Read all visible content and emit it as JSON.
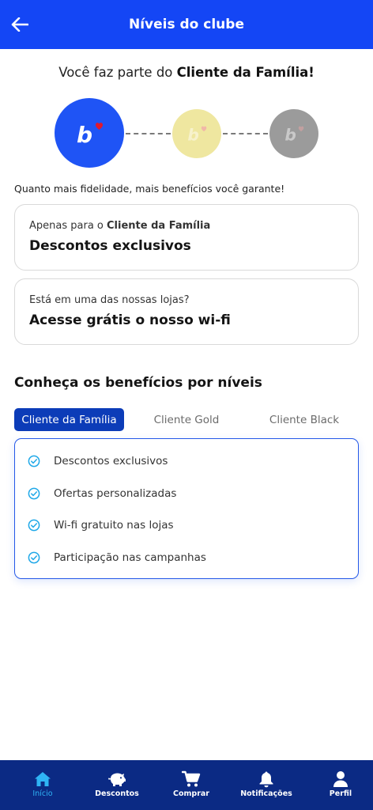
{
  "header": {
    "title": "Níveis do clube",
    "back_icon": "arrow-left-icon",
    "color": "#1446f5"
  },
  "membership": {
    "prefix": "Você faz parte do ",
    "level_name": "Cliente da Família!"
  },
  "levels": [
    {
      "name": "Cliente da Família",
      "color": "#1f54f5",
      "icon": "brand-b-heart-icon",
      "active": true
    },
    {
      "name": "Cliente Gold",
      "color": "#efe7a0",
      "icon": "brand-b-heart-icon",
      "active": false
    },
    {
      "name": "Cliente Black",
      "color": "#9b9b9b",
      "icon": "brand-b-heart-icon",
      "active": false
    }
  ],
  "intro": "Quanto mais fidelidade, mais benefícios você garante!",
  "cards": [
    {
      "small_prefix": "Apenas para o ",
      "small_bold": "Cliente da Família",
      "title": "Descontos exclusivos"
    },
    {
      "small_prefix": "Está em uma das nossas lojas?",
      "small_bold": "",
      "title": "Acesse grátis o nosso wi-fi"
    }
  ],
  "section_title": "Conheça os benefícios por níveis",
  "tabs": [
    {
      "label": "Cliente da Família",
      "active": true
    },
    {
      "label": "Cliente Gold",
      "active": false
    },
    {
      "label": "Cliente Black",
      "active": false
    }
  ],
  "benefits": [
    {
      "label": "Descontos exclusivos",
      "icon": "check-circle-icon"
    },
    {
      "label": "Ofertas personalizadas",
      "icon": "check-circle-icon"
    },
    {
      "label": "Wi-fi gratuito nas lojas",
      "icon": "check-circle-icon"
    },
    {
      "label": "Participação nas campanhas",
      "icon": "check-circle-icon"
    }
  ],
  "bottom_nav": [
    {
      "label": "Início",
      "icon": "home-icon",
      "active": true
    },
    {
      "label": "Descontos",
      "icon": "piggy-bank-icon",
      "active": false
    },
    {
      "label": "Comprar",
      "icon": "cart-icon",
      "active": false
    },
    {
      "label": "Notificações",
      "icon": "bell-icon",
      "active": false
    },
    {
      "label": "Perfil",
      "icon": "user-icon",
      "active": false
    }
  ],
  "colors": {
    "primary": "#1446f5",
    "active_tab": "#0c3cb8",
    "nav_bg": "#0b2a84",
    "nav_active": "#2fb4f5",
    "check": "#1fa8e8",
    "heart": "#e0182d"
  }
}
